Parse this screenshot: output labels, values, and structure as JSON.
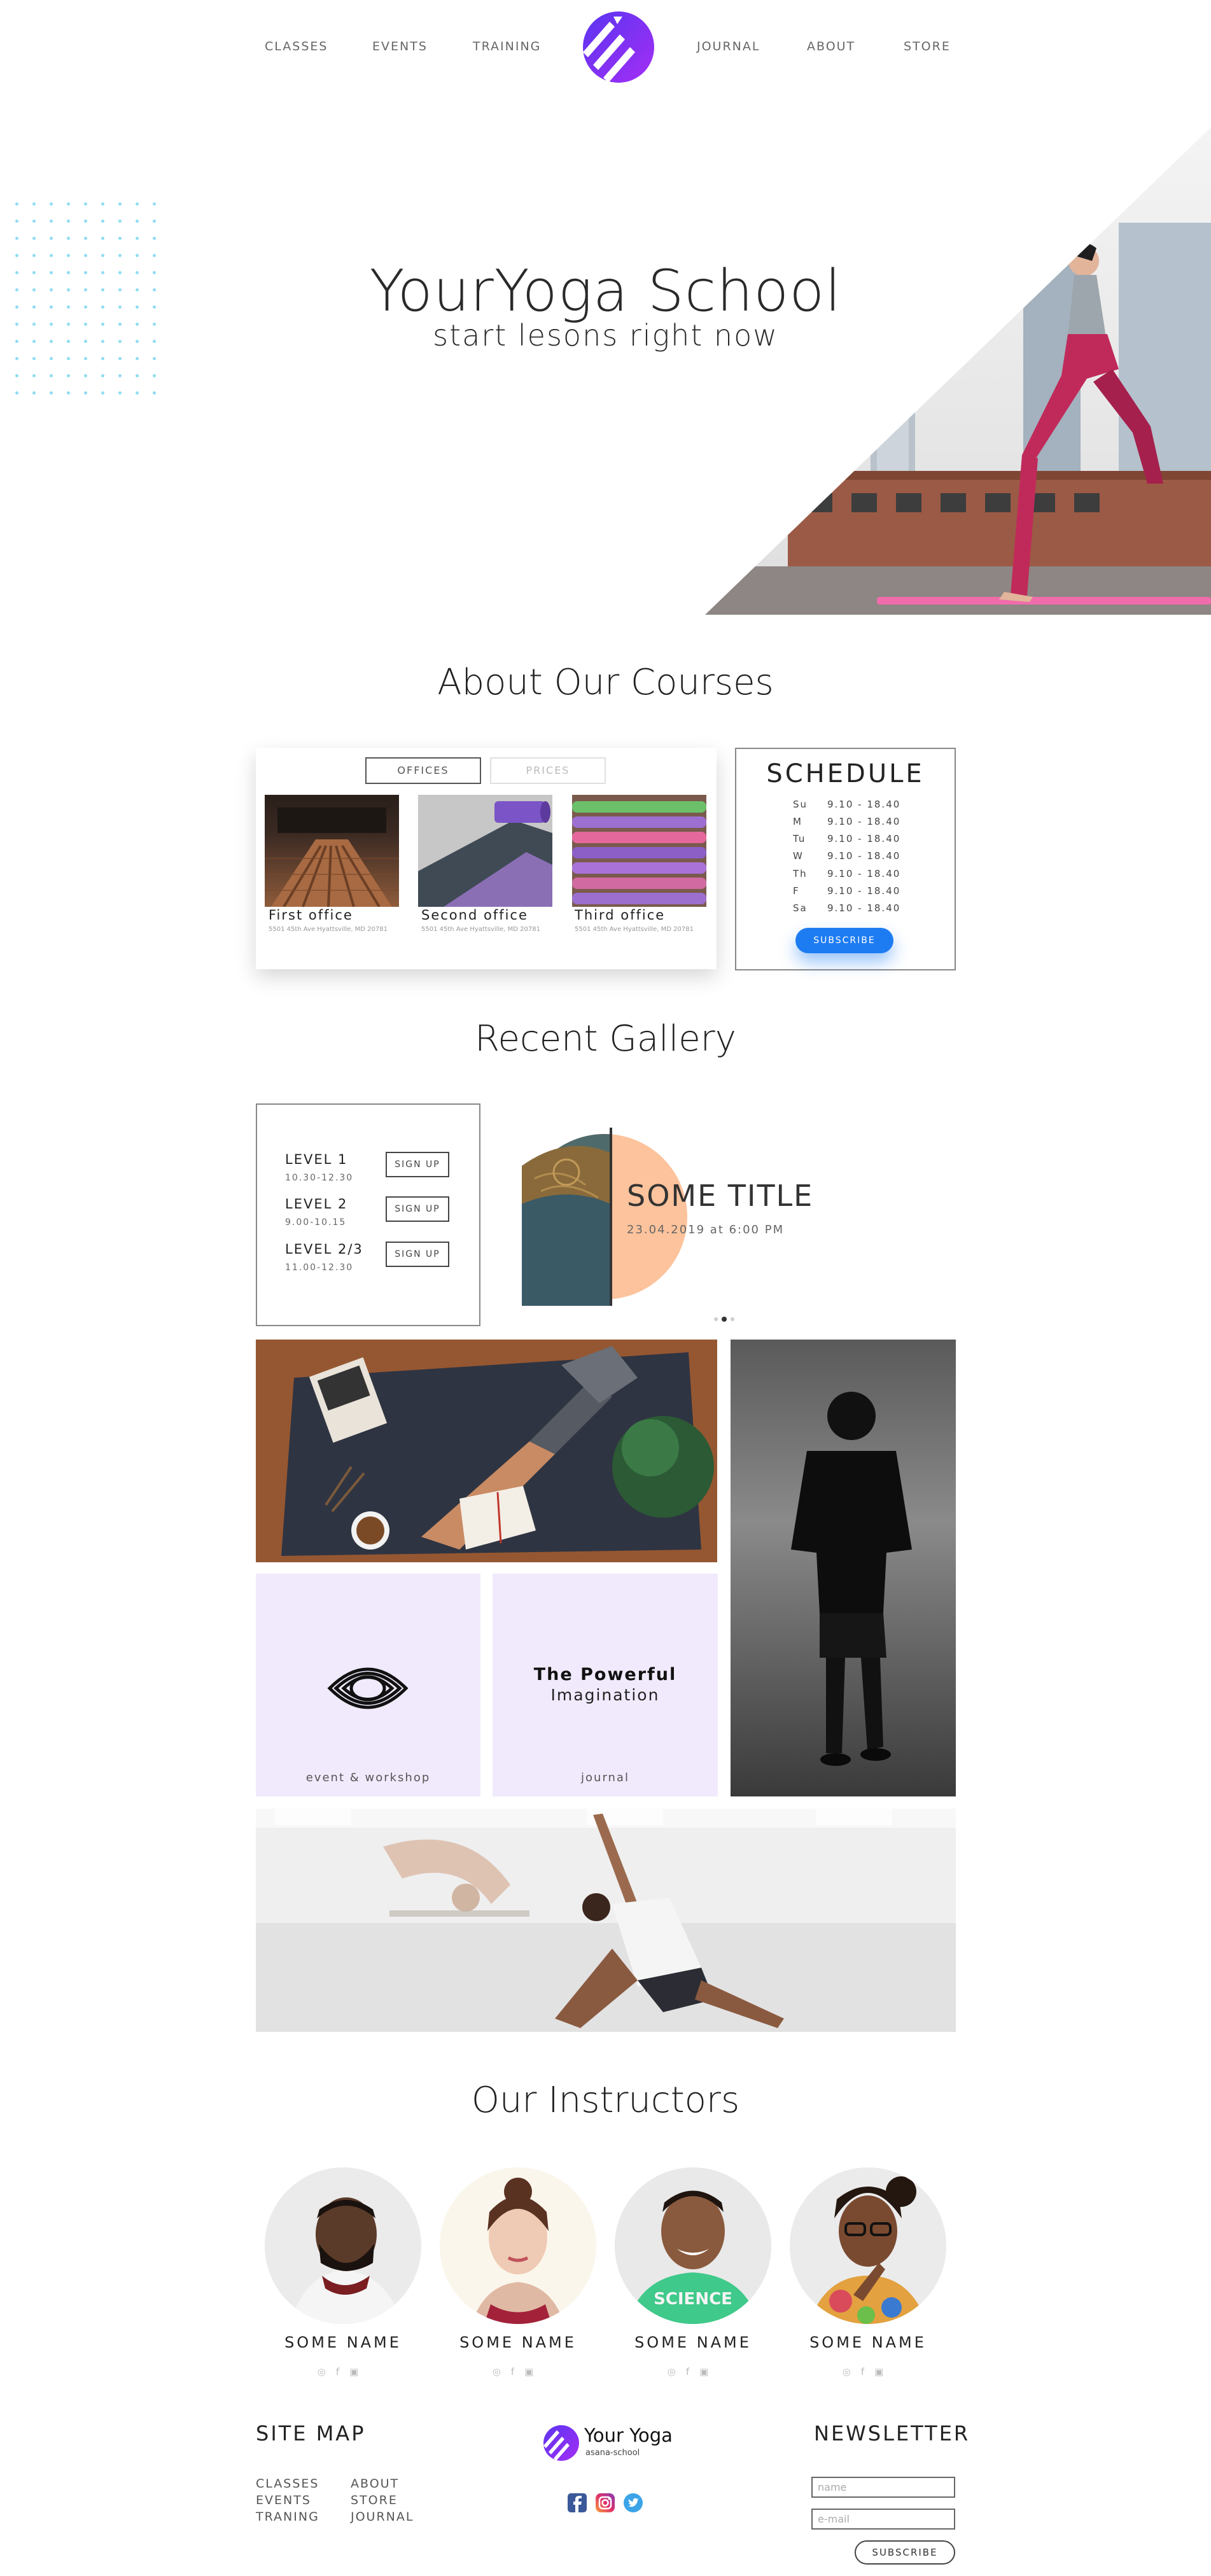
{
  "nav": {
    "left": [
      "CLASSES",
      "EVENTS",
      "TRAINING"
    ],
    "right": [
      "JOURNAL",
      "ABOUT",
      "STORE"
    ],
    "logo_icon": "yoga-stripes-logo"
  },
  "hero": {
    "title": "YourYoga School",
    "subtitle": "start lesons right now"
  },
  "about": {
    "heading": "About Our Courses",
    "tabs": [
      "OFFICES",
      "PRICES"
    ],
    "offices": [
      {
        "name": "First office",
        "address": "5501 45th Ave Hyattsville, MD 20781"
      },
      {
        "name": "Second office",
        "address": "5501 45th Ave Hyattsville, MD 20781"
      },
      {
        "name": "Third office",
        "address": "5501 45th Ave Hyattsville, MD 20781"
      }
    ],
    "schedule": {
      "title": "SCHEDULE",
      "rows": [
        {
          "day": "Su",
          "time": "9.10 - 18.40"
        },
        {
          "day": "M",
          "time": "9.10 - 18.40"
        },
        {
          "day": "Tu",
          "time": "9.10 - 18.40"
        },
        {
          "day": "W",
          "time": "9.10 - 18.40"
        },
        {
          "day": "Th",
          "time": "9.10 - 18.40"
        },
        {
          "day": "F",
          "time": "9.10 - 18.40"
        },
        {
          "day": "Sa",
          "time": "9.10 - 18.40"
        }
      ],
      "button": "SUBSCRIBE"
    }
  },
  "gallery": {
    "heading": "Recent Gallery",
    "levels": [
      {
        "name": "LEVEL 1",
        "time": "10.30-12.30",
        "button": "SIGN UP"
      },
      {
        "name": "LEVEL 2",
        "time": "9.00-10.15",
        "button": "SIGN UP"
      },
      {
        "name": "LEVEL 2/3",
        "time": "11.00-12.30",
        "button": "SIGN UP"
      }
    ],
    "slide": {
      "title": "SOME TITLE",
      "date": "23.04.2019 at 6:00 PM"
    },
    "tile_event": "event & workshop",
    "tile_journal_title": "The Powerful",
    "tile_journal_subtitle": "Imagination",
    "tile_journal_caption": "journal"
  },
  "instructors": {
    "heading": "Our Instructors",
    "people": [
      {
        "name": "SOME NAME",
        "icons": [
          "instagram-icon",
          "facebook-icon",
          "twitter-icon"
        ]
      },
      {
        "name": "SOME NAME",
        "icons": [
          "instagram-icon",
          "facebook-icon",
          "twitter-icon"
        ]
      },
      {
        "name": "SOME NAME",
        "icons": [
          "instagram-icon",
          "facebook-icon",
          "twitter-icon"
        ]
      },
      {
        "name": "SOME NAME",
        "icons": [
          "instagram-icon",
          "facebook-icon",
          "twitter-icon"
        ]
      }
    ]
  },
  "footer": {
    "sitemap_title": "SITE MAP",
    "sitemap_col1": [
      "CLASSES",
      "EVENTS",
      "TRANING"
    ],
    "sitemap_col2": [
      "ABOUT",
      "STORE",
      "JOURNAL"
    ],
    "logo_name": "Your Yoga",
    "logo_sub": "asana-school",
    "social": [
      "facebook-icon",
      "instagram-icon",
      "twitter-icon"
    ],
    "newsletter_title": "NEWSLETTER",
    "name_placeholder": "name",
    "email_placeholder": "e-mail",
    "subscribe": "SUBSCRIBE"
  },
  "colors": {
    "accent_purple": "#7b2ff7",
    "blue_button": "#1e7cf2",
    "tile_lavender": "#f1eafd",
    "dots": "#8fdcf3"
  }
}
